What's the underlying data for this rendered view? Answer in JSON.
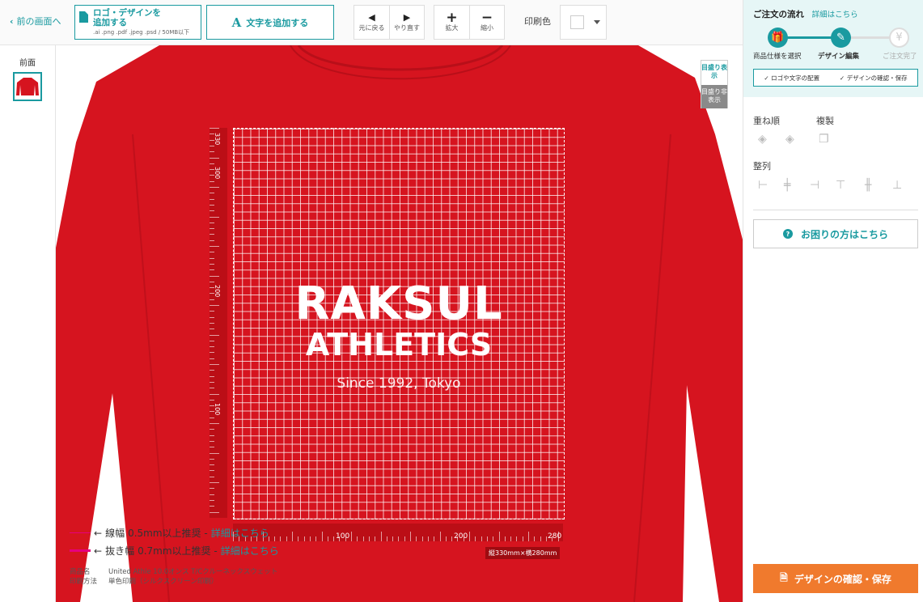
{
  "toolbar": {
    "back_label": "前の画面へ",
    "add_logo_label_1": "ロゴ・デザインを",
    "add_logo_label_2": "追加する",
    "add_logo_formats": ".ai .png .pdf .jpeg .psd / 50MB以下",
    "add_text_label": "文字を追加する",
    "undo_label": "元に戻る",
    "redo_label": "やり直す",
    "zoom_in_label": "拡大",
    "zoom_out_label": "縮小",
    "print_color_label": "印刷色",
    "print_color_value": "#ffffff"
  },
  "sides": {
    "front_label": "前面"
  },
  "canvas": {
    "shirt_color": "#d6141f",
    "design_line1": "RAKSUL",
    "design_line2": "ATHLETICS",
    "design_line3": "Since 1992, Tokyo",
    "ruler_v_labels": [
      "330",
      "300",
      "200",
      "100"
    ],
    "ruler_h_labels": [
      "100",
      "200",
      "280"
    ],
    "print_area_size": "縦330mm×横280mm",
    "grid_toggle_on": "目盛り表示",
    "grid_toggle_off": "目盛り非表示",
    "legend_line_label": "線幅",
    "legend_line_value": "0.5mm以上推奨 -",
    "legend_knockout_label": "抜き幅",
    "legend_knockout_value": "0.7mm以上推奨 -",
    "legend_link": "詳細はこちら",
    "legend_line_color": "#e6007e",
    "product_name_label": "商品名",
    "product_name": "United Athle 10.0オンス T/Cクルーネックスウェット",
    "print_method_label": "印刷方法",
    "print_method": "単色印刷（シルクスクリーン印刷）"
  },
  "sidebar": {
    "flow_title": "ご注文の流れ",
    "flow_link": "詳細はこちら",
    "step1": "商品仕様を選択",
    "step2": "デザイン編集",
    "step3": "ご注文完了",
    "sub1": "✓ ロゴや文字の配置",
    "sub2": "✓ デザインの確認・保存",
    "order_label": "重ね順",
    "duplicate_label": "複製",
    "align_label": "整列",
    "help_label": "お困りの方はこちら",
    "save_label": "デザインの確認・保存",
    "accent": "#1a9aa0",
    "save_color": "#f07a2d"
  }
}
